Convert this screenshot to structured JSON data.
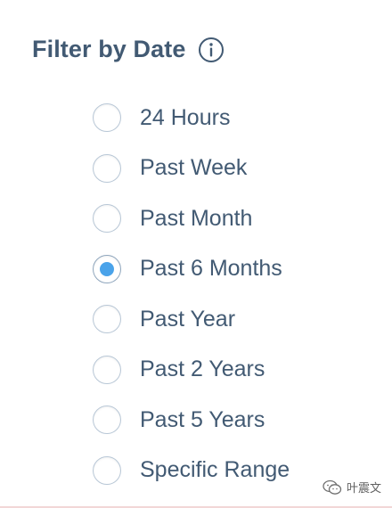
{
  "filter": {
    "title": "Filter by Date",
    "info_icon": "info-circle-icon",
    "options": [
      {
        "label": "24 Hours",
        "selected": false
      },
      {
        "label": "Past Week",
        "selected": false
      },
      {
        "label": "Past Month",
        "selected": false
      },
      {
        "label": "Past 6 Months",
        "selected": true
      },
      {
        "label": "Past Year",
        "selected": false
      },
      {
        "label": "Past 2 Years",
        "selected": false
      },
      {
        "label": "Past 5 Years",
        "selected": false
      },
      {
        "label": "Specific Range",
        "selected": false
      }
    ]
  },
  "watermark": {
    "text": "叶震文",
    "icon": "wechat-icon"
  },
  "colors": {
    "text": "#425a73",
    "accent": "#4aa3ea",
    "radio_border": "#b8c7d6"
  }
}
